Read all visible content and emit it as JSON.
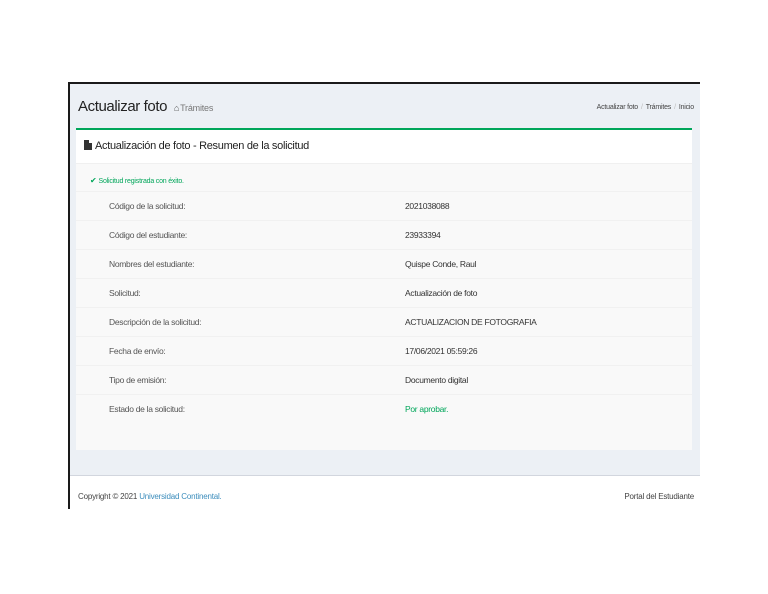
{
  "header": {
    "title": "Actualizar foto",
    "subtitle": "Trámites",
    "home_icon": "home-icon",
    "breadcrumb": [
      "Actualizar foto",
      "Trámites",
      "Inicio"
    ]
  },
  "box": {
    "title": "Actualización de foto - Resumen de la solicitud",
    "title_icon": "file-icon",
    "success_message": "Solicitud registrada con éxito.",
    "rows": [
      {
        "label": "Código de la solicitud:",
        "value": "2021038088"
      },
      {
        "label": "Código del estudiante:",
        "value": "23933394"
      },
      {
        "label": "Nombres del estudiante:",
        "value": "Quispe Conde, Raul"
      },
      {
        "label": "Solicitud:",
        "value": "Actualización de foto"
      },
      {
        "label": "Descripción de la solicitud:",
        "value": "ACTUALIZACION DE FOTOGRAFIA"
      },
      {
        "label": "Fecha de envío:",
        "value": "17/06/2021 05:59:26"
      },
      {
        "label": "Tipo de emisión:",
        "value": "Documento digital"
      },
      {
        "label": "Estado de la solicitud:",
        "value": "Por aprobar."
      }
    ]
  },
  "footer": {
    "copyright_prefix": "Copyright © 2021",
    "university": "Universidad Continental.",
    "portal": "Portal del Estudiante"
  },
  "colors": {
    "accent": "#00a65a",
    "link": "#3c8dbc",
    "background": "#ecf0f5"
  }
}
